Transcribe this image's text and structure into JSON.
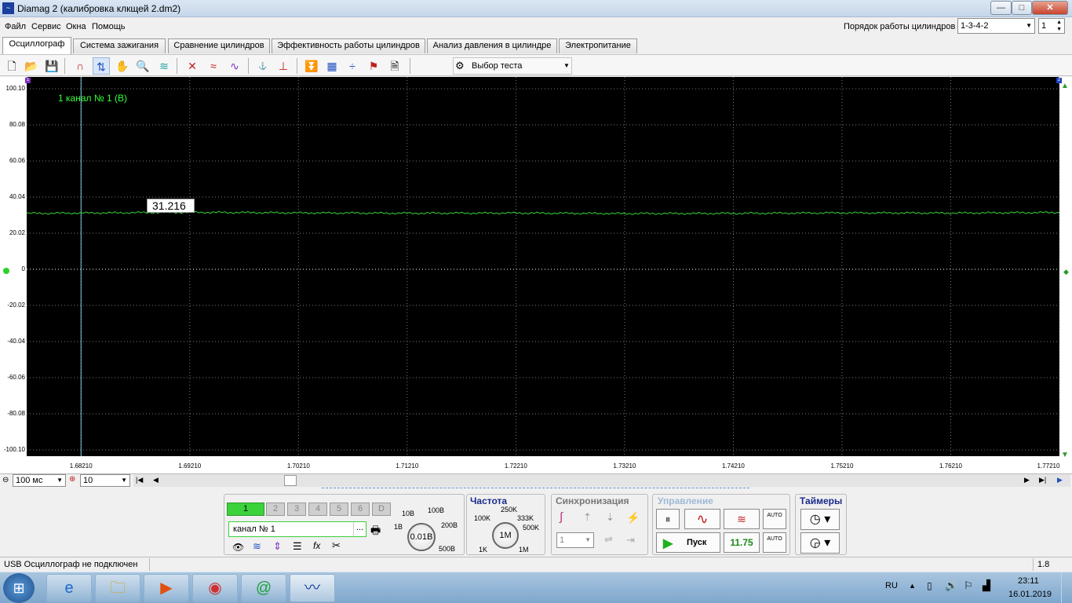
{
  "window": {
    "title": "Diamag 2 (калибровка клкщей 2.dm2)",
    "minimize": "—",
    "maximize": "□",
    "close": "✕"
  },
  "menu": [
    "Файл",
    "Сервис",
    "Окна",
    "Помощь"
  ],
  "cylinder_order": {
    "label": "Порядок работы цилиндров",
    "value": "1-3-4-2",
    "count": "1"
  },
  "tabs": [
    "Осциллограф",
    "Система зажигания",
    "Сравнение цилиндров",
    "Эффективность работы цилиндров",
    "Анализ давления в цилиндре",
    "Электропитание"
  ],
  "toolbar": {
    "test_select": "Выбор теста"
  },
  "scope": {
    "channel_label": "1  канал № 1 (В)",
    "cursor_value": "31.216",
    "y_ticks": [
      "100.10",
      "80.08",
      "60.06",
      "40.04",
      "20.02",
      "0",
      "-20.02",
      "-40.04",
      "-60.06",
      "-80.08",
      "-100.10"
    ],
    "x_ticks": [
      "1.68210",
      "1.69210",
      "1.70210",
      "1.71210",
      "1.72210",
      "1.73210",
      "1.74210",
      "1.75210",
      "1.76210",
      "1.77210"
    ],
    "marker_left": "1",
    "marker_right": "2",
    "colors": {
      "trace": "#35d435",
      "grid": "#7a7a7a",
      "background": "#000000",
      "cursor": "#7fd3e8"
    }
  },
  "chart_data": {
    "type": "line",
    "title": "",
    "series": [
      {
        "name": "канал № 1 (В)",
        "x": [
          1.6771,
          1.6821,
          1.6921,
          1.7021,
          1.7121,
          1.7221,
          1.7321,
          1.7421,
          1.7521,
          1.7621,
          1.7721
        ],
        "y": [
          31.0,
          31.2,
          31.6,
          31.3,
          31.1,
          31.2,
          30.9,
          31.0,
          31.3,
          31.2,
          31.5
        ]
      }
    ],
    "xlim": [
      1.6771,
      1.7721
    ],
    "ylim": [
      -100.1,
      100.1
    ],
    "grid": true
  },
  "controls": {
    "timebase": "100 мс",
    "points": "10"
  },
  "channels": {
    "buttons": [
      "1",
      "2",
      "3",
      "4",
      "5",
      "6",
      "D"
    ],
    "name": "канал № 1",
    "dots": "...",
    "knob_value": "0.01В",
    "knob_labels": [
      "10В",
      "100В",
      "1В",
      "200В",
      "500В"
    ]
  },
  "frequency": {
    "title": "Частота",
    "value": "1M",
    "labels": [
      "250K",
      "100K",
      "333K",
      "500K",
      "1K",
      "1M"
    ]
  },
  "sync": {
    "title": "Синхронизация",
    "channel": "1"
  },
  "control": {
    "title": "Управление",
    "start": "Пуск",
    "voltage": "11.75",
    "auto": "AUTO"
  },
  "timers": {
    "title": "Таймеры"
  },
  "status": {
    "text": "USB Осциллограф не подключен",
    "version": "1.8"
  },
  "taskbar": {
    "lang": "RU",
    "time": "23:11",
    "date": "16.01.2019"
  }
}
